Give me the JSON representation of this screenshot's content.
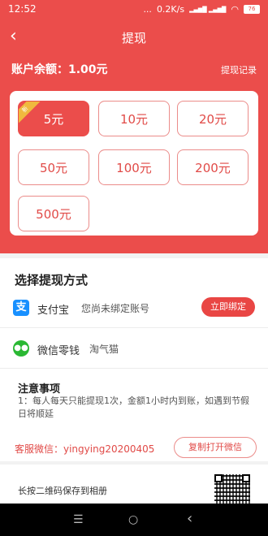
{
  "status_bar": {
    "time": "12:52",
    "dots": "...",
    "speed": "0.2K/s",
    "signal": "▂▄▆█ ▂▄▆█",
    "wifi": "◠",
    "battery": "76"
  },
  "nav": {
    "back_icon": "‹",
    "title": "提现"
  },
  "balance": {
    "text": "账户余额：1.00元",
    "record_link": "提现记录"
  },
  "amounts": {
    "new_tag": "新",
    "items": [
      "5元",
      "10元",
      "20元",
      "50元",
      "100元",
      "200元",
      "500元"
    ],
    "selected_index": 0
  },
  "method": {
    "section_title": "选择提现方式",
    "alipay": {
      "icon": "支",
      "name": "支付宝",
      "status": "您尚未绑定账号",
      "bind_button": "立即绑定"
    },
    "wechat": {
      "icon": "●●",
      "name": "微信零钱",
      "nickname": "淘气猫"
    }
  },
  "notes": {
    "title": "注意事项",
    "text": "1：每人每天只能提现1次，金额1小时内到账，如遇到节假日将顺延"
  },
  "service": {
    "text": "客服微信：yingying20200405",
    "copy_button": "复制打开微信"
  },
  "qr": {
    "label": "长按二维码保存到相册"
  },
  "android_nav": {
    "menu": "☰",
    "home": "○",
    "back": "‹"
  },
  "colors": {
    "primary_red": "#eb4d4b",
    "alipay_blue": "#1890ff",
    "wechat_green": "#2ab833",
    "new_tag_gold": "#f0b93e"
  }
}
